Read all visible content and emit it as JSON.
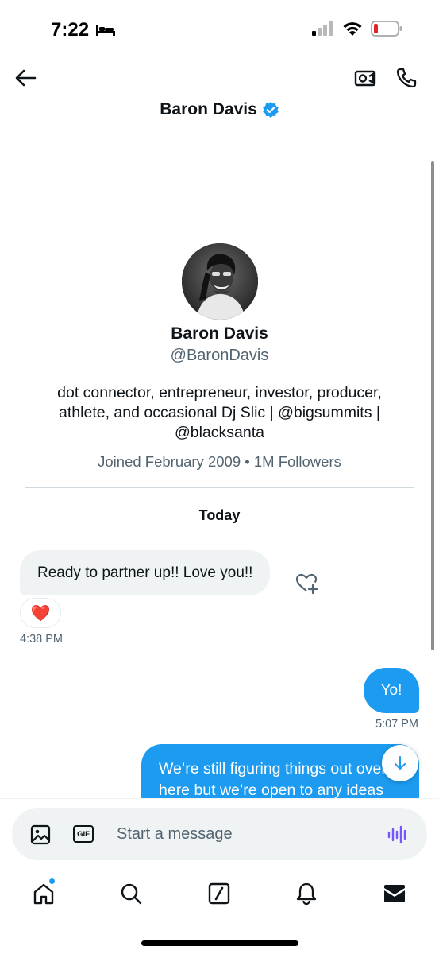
{
  "status_bar": {
    "time": "7:22"
  },
  "header": {
    "title": "Baron Davis"
  },
  "profile": {
    "name": "Baron Davis",
    "handle": "@BaronDavis",
    "bio": "dot connector, entrepreneur, investor, producer, athlete, and occasional Dj Slic | @bigsummits | @blacksanta",
    "meta": "Joined February 2009 • 1M Followers"
  },
  "conversation": {
    "day_label": "Today",
    "messages": [
      {
        "direction": "incoming",
        "text": "Ready to partner up!!  Love you!!",
        "reaction": "❤️",
        "time": "4:38 PM"
      },
      {
        "direction": "outgoing",
        "text": "Yo!",
        "time": "5:07 PM"
      },
      {
        "direction": "outgoing",
        "text": "We’re still figuring things out over here but we’re open to any ideas"
      }
    ]
  },
  "composer": {
    "placeholder": "Start a message"
  },
  "colors": {
    "accent": "#1d9bf0",
    "incoming_bubble": "#eff3f4",
    "secondary_text": "#536471",
    "voice_icon": "#7856ff"
  },
  "icons": {
    "back": "arrow-left-icon",
    "video": "video-camera-icon",
    "phone": "phone-icon",
    "verified": "verified-badge-icon",
    "add_reaction": "heart-plus-icon",
    "scroll_down": "arrow-down-icon",
    "image": "image-icon",
    "gif": "gif-icon",
    "voice": "voice-wave-icon",
    "tabs": [
      "home-icon",
      "search-icon",
      "grok-icon",
      "bell-icon",
      "mail-icon"
    ]
  }
}
